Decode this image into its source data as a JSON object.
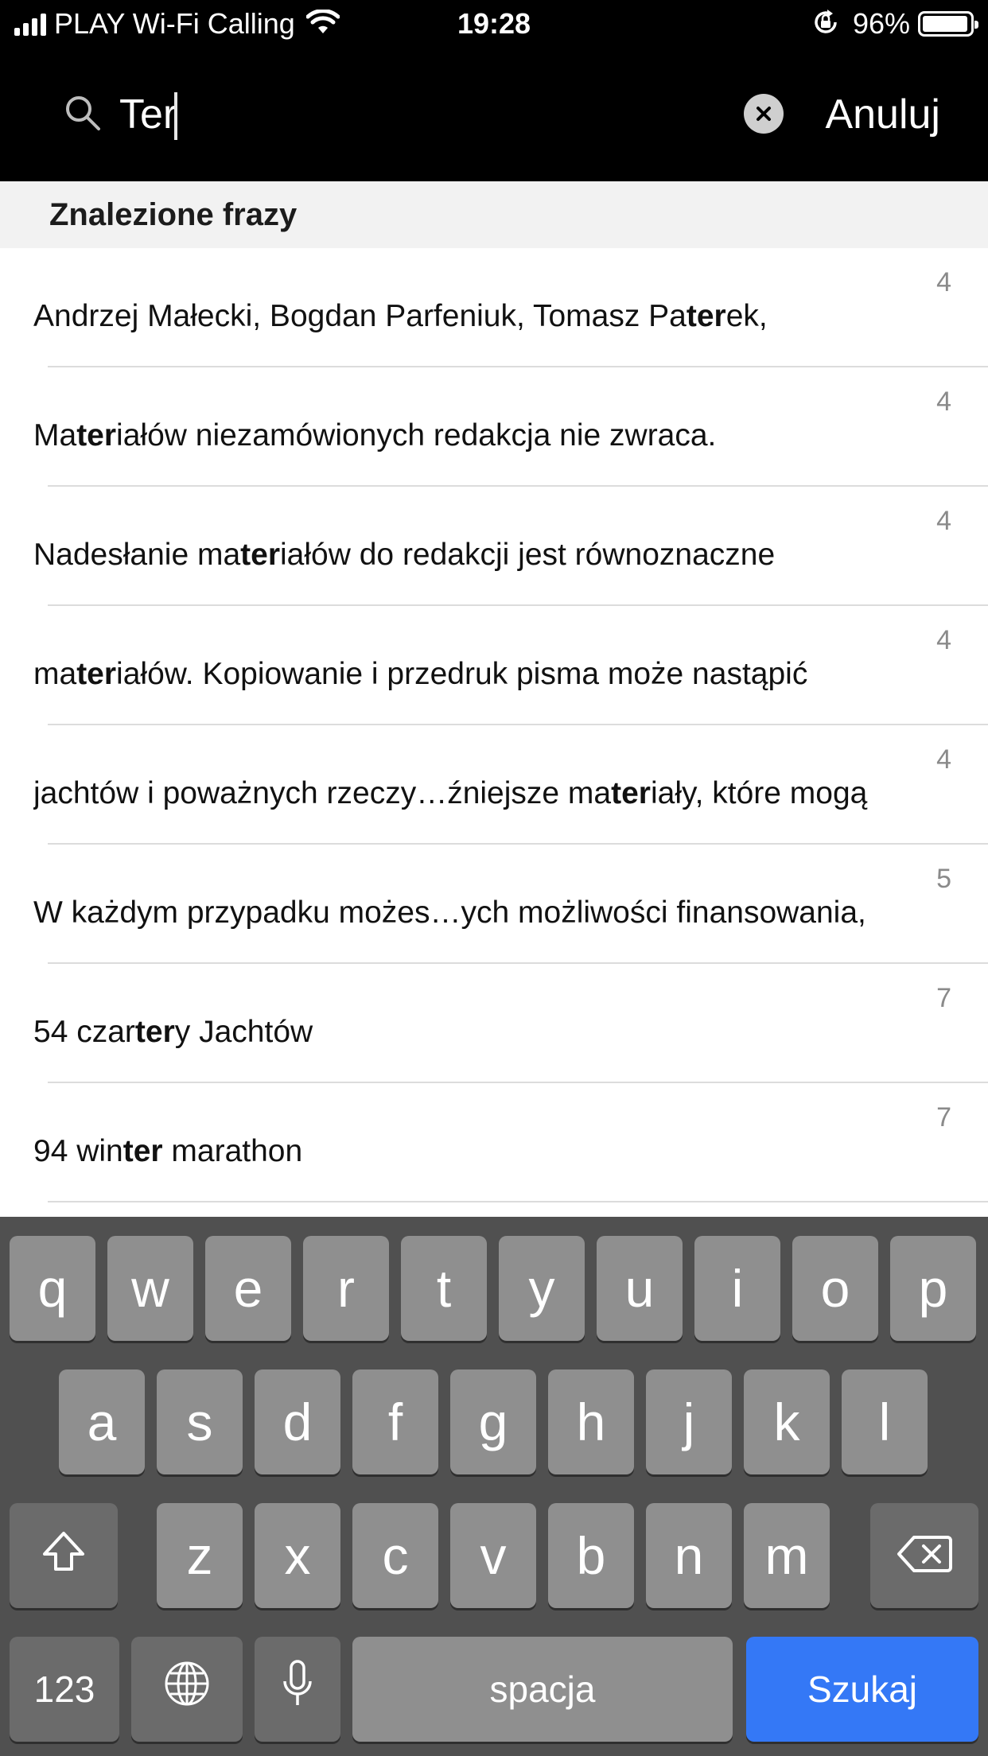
{
  "status_bar": {
    "carrier": "PLAY Wi-Fi Calling",
    "time": "19:28",
    "battery_percent": "96%",
    "battery_level": 0.96,
    "signal_bars": 4,
    "icons": [
      "signal-icon",
      "wifi-icon",
      "rotation-lock-icon",
      "battery-icon"
    ]
  },
  "search": {
    "query": "Ter",
    "placeholder": "",
    "cancel_label": "Anuluj",
    "icons": [
      "search-icon",
      "clear-icon"
    ]
  },
  "section": {
    "title": "Znalezione frazy"
  },
  "results": [
    {
      "count": "4",
      "parts": [
        "Andrzej Małecki, Bogdan Parfeniuk, Tomasz Pa",
        "ter",
        "ek,"
      ]
    },
    {
      "count": "4",
      "parts": [
        "Ma",
        "ter",
        "iałów niezamówionych redakcja nie zwraca."
      ]
    },
    {
      "count": "4",
      "parts": [
        "Nadesłanie ma",
        "ter",
        "iałów do redakcji jest równoznaczne"
      ]
    },
    {
      "count": "4",
      "parts": [
        "ma",
        "ter",
        "iałów. Kopiowanie i przedruk pisma może nastąpić"
      ]
    },
    {
      "count": "4",
      "parts": [
        "jachtów i poważnych rzeczy…źniejsze ma",
        "ter",
        "iały, które mogą"
      ]
    },
    {
      "count": "5",
      "parts": [
        "W każdym przypadku możes…ych możliwości finansowania,",
        "",
        ""
      ]
    },
    {
      "count": "7",
      "parts": [
        "54 czar",
        "ter",
        "y Jachtów"
      ]
    },
    {
      "count": "7",
      "parts": [
        "94 win",
        "ter",
        " marathon"
      ]
    }
  ],
  "keyboard": {
    "row1": [
      "q",
      "w",
      "e",
      "r",
      "t",
      "y",
      "u",
      "i",
      "o",
      "p"
    ],
    "row2": [
      "a",
      "s",
      "d",
      "f",
      "g",
      "h",
      "j",
      "k",
      "l"
    ],
    "row3": [
      "z",
      "x",
      "c",
      "v",
      "b",
      "n",
      "m"
    ],
    "numbers_label": "123",
    "space_label": "spacja",
    "search_label": "Szukaj",
    "icons": [
      "shift-icon",
      "backspace-icon",
      "globe-icon",
      "microphone-icon"
    ],
    "accent_color": "#3478f6"
  }
}
